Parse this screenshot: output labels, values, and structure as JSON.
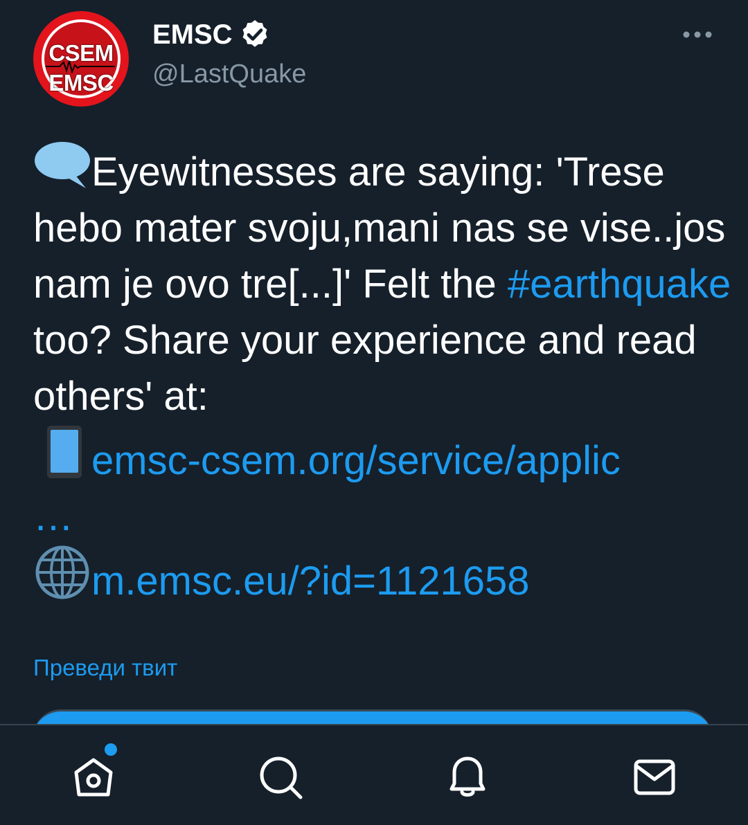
{
  "author": {
    "display_name": "EMSC",
    "handle": "@LastQuake",
    "verified": true,
    "avatar_text_top": "CSEM",
    "avatar_text_bottom": "EMSC"
  },
  "tweet": {
    "line1_text": "Eyewitnesses are saying:",
    "line2_text": "'Trese hebo mater svoju,mani nas se vise..jos nam je ovo tre[...]' Felt the ",
    "hashtag": "#earthquake",
    "line3_text": " too? Share your experience and read others' at:",
    "link1": "emsc-csem.org/service/applic",
    "link1_ellipsis": "…",
    "link2": "m.emsc.eu/?id=1121658",
    "emoji_1": "speech-balloon",
    "emoji_2": "mobile-phone",
    "emoji_3": "globe"
  },
  "translate_label": "Преведи твит",
  "bottom_nav": [
    {
      "icon": "home-icon",
      "has_notification_dot": true
    },
    {
      "icon": "search-icon"
    },
    {
      "icon": "bell-icon"
    },
    {
      "icon": "mail-icon"
    }
  ],
  "colors": {
    "background": "#15202b",
    "link": "#1d9bf0",
    "secondary_text": "#8899a6",
    "avatar_red": "#e3141c"
  }
}
